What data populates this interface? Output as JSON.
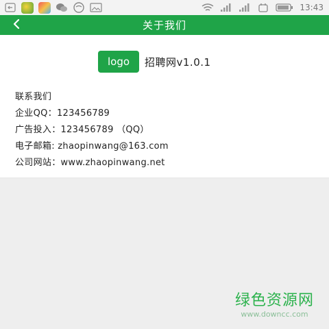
{
  "status_bar": {
    "time": "13:43",
    "icons": [
      "back-key-icon",
      "app-icon-1",
      "app-icon-2",
      "wechat-icon",
      "message-icon",
      "image-icon",
      "wifi-icon",
      "signal-icon",
      "signal-icon-2",
      "alarm-icon",
      "battery-icon"
    ]
  },
  "header": {
    "title": "关于我们",
    "back_icon": "chevron-left-icon"
  },
  "about": {
    "logo_text": "logo",
    "app_name": "招聘网v1.0.1"
  },
  "contact": {
    "heading": "联系我们",
    "lines": [
      "企业QQ：123456789",
      "广告投入：123456789 （QQ）",
      "电子邮箱: zhaopinwang@163.com",
      "公司网站：www.zhaopinwang.net"
    ]
  },
  "watermark": {
    "title": "绿色资源网",
    "url": "www.downcc.com"
  },
  "colors": {
    "brand_green": "#1fa448",
    "background": "#eeeeee"
  }
}
